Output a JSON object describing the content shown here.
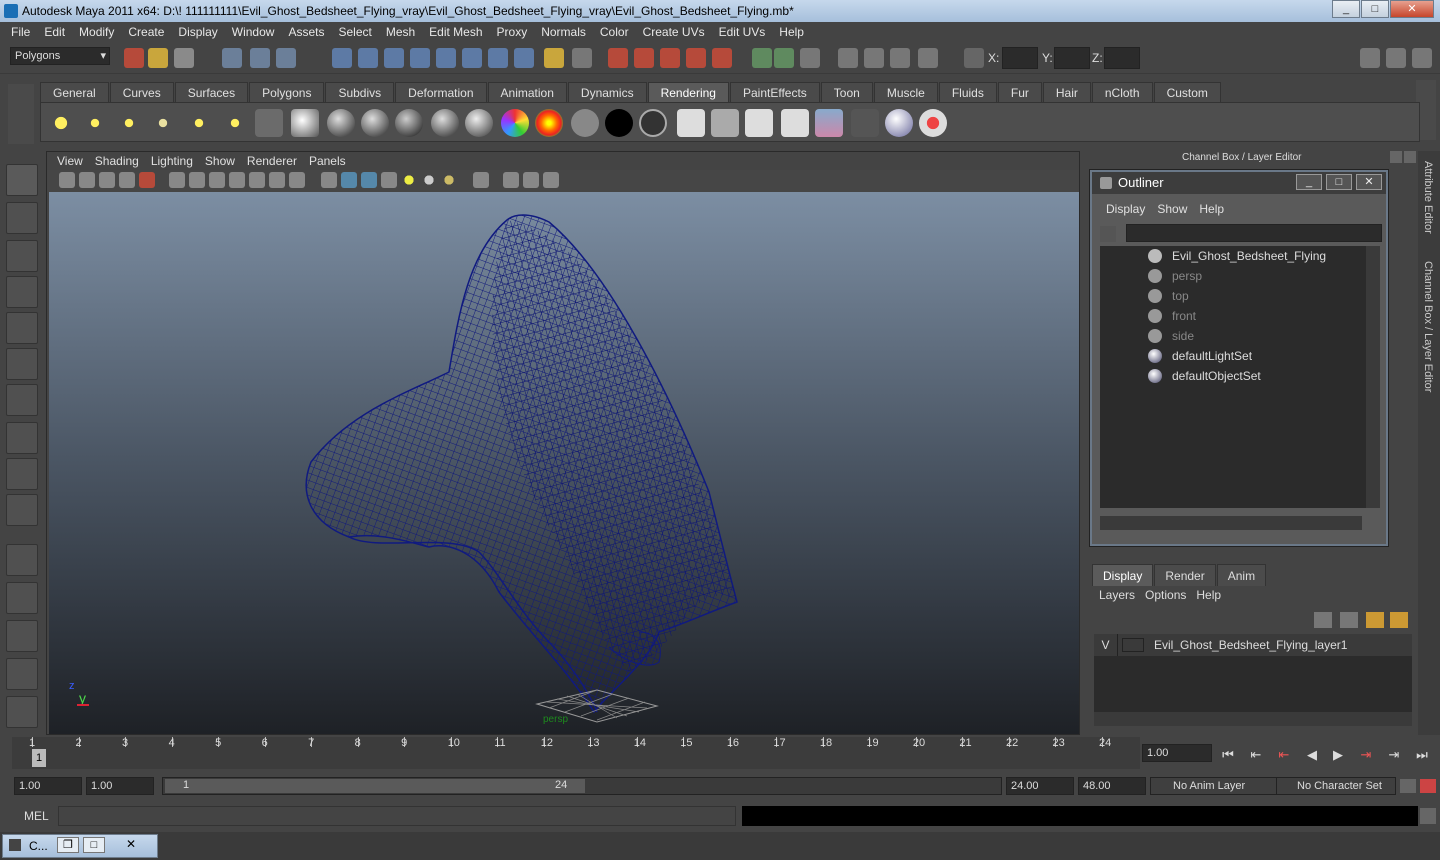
{
  "window": {
    "title": "Autodesk Maya 2011 x64: D:\\! 111111111\\Evil_Ghost_Bedsheet_Flying_vray\\Evil_Ghost_Bedsheet_Flying_vray\\Evil_Ghost_Bedsheet_Flying.mb*"
  },
  "menubar": [
    "File",
    "Edit",
    "Modify",
    "Create",
    "Display",
    "Window",
    "Assets",
    "Select",
    "Mesh",
    "Edit Mesh",
    "Proxy",
    "Normals",
    "Color",
    "Create UVs",
    "Edit UVs",
    "Help"
  ],
  "statusline": {
    "mode": "Polygons",
    "x_label": "X:",
    "y_label": "Y:",
    "z_label": "Z:"
  },
  "shelf": {
    "tabs": [
      "General",
      "Curves",
      "Surfaces",
      "Polygons",
      "Subdivs",
      "Deformation",
      "Animation",
      "Dynamics",
      "Rendering",
      "PaintEffects",
      "Toon",
      "Muscle",
      "Fluids",
      "Fur",
      "Hair",
      "nCloth",
      "Custom"
    ],
    "active": "Rendering"
  },
  "viewport": {
    "menu": [
      "View",
      "Shading",
      "Lighting",
      "Show",
      "Renderer",
      "Panels"
    ],
    "camera_label": "persp",
    "axis_z": "z",
    "axis_y": "y"
  },
  "outliner": {
    "panel_title": "Channel Box / Layer Editor",
    "title": "Outliner",
    "menu": [
      "Display",
      "Show",
      "Help"
    ],
    "items": [
      {
        "label": "Evil_Ghost_Bedsheet_Flying",
        "dim": false,
        "icon": "transform-icon"
      },
      {
        "label": "persp",
        "dim": true,
        "icon": "camera-icon"
      },
      {
        "label": "top",
        "dim": true,
        "icon": "camera-icon"
      },
      {
        "label": "front",
        "dim": true,
        "icon": "camera-icon"
      },
      {
        "label": "side",
        "dim": true,
        "icon": "camera-icon"
      },
      {
        "label": "defaultLightSet",
        "dim": false,
        "icon": "set-icon"
      },
      {
        "label": "defaultObjectSet",
        "dim": false,
        "icon": "set-icon"
      }
    ]
  },
  "side_tabs": [
    "Attribute Editor",
    "Channel Box / Layer Editor"
  ],
  "layers": {
    "tabs": [
      "Display",
      "Render",
      "Anim"
    ],
    "active": "Display",
    "menu": [
      "Layers",
      "Options",
      "Help"
    ],
    "rows": [
      {
        "visible": "V",
        "name": "Evil_Ghost_Bedsheet_Flying_layer1"
      }
    ]
  },
  "timeline": {
    "ticks": [
      "1",
      "2",
      "3",
      "4",
      "5",
      "6",
      "7",
      "8",
      "9",
      "10",
      "11",
      "12",
      "13",
      "14",
      "15",
      "16",
      "17",
      "18",
      "19",
      "20",
      "21",
      "22",
      "23",
      "24"
    ],
    "current": "1",
    "current_time": "1.00"
  },
  "range": {
    "start": "1.00",
    "start_inner": "1.00",
    "slider_min": "1",
    "slider_max": "24",
    "end_inner": "24.00",
    "end": "48.00",
    "anim_layer": "No Anim Layer",
    "character_set": "No Character Set"
  },
  "command": {
    "label": "MEL"
  },
  "taskbar": {
    "item": "C..."
  }
}
